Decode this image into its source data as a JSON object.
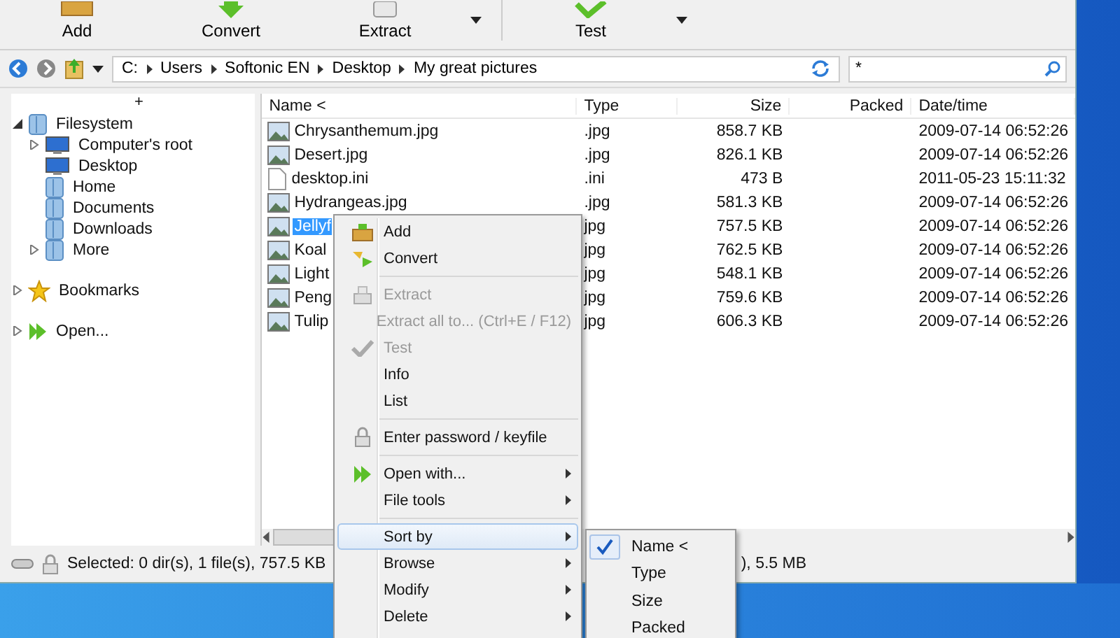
{
  "toolbar": {
    "buttons": [
      {
        "label": "Add",
        "dropdown": false
      },
      {
        "label": "Convert",
        "dropdown": false
      },
      {
        "label": "Extract",
        "dropdown": true
      },
      {
        "label": "Test",
        "dropdown": true
      }
    ]
  },
  "address_bar": {
    "path": [
      "C:",
      "Users",
      "Softonic EN",
      "Desktop",
      "My great pictures"
    ],
    "filter": "*"
  },
  "sidebar": {
    "expand_mark": "+",
    "items": [
      {
        "label": "Filesystem",
        "expanded": true,
        "children": [
          {
            "label": "Computer's root",
            "expanded": false
          },
          {
            "label": "Desktop"
          },
          {
            "label": "Home"
          },
          {
            "label": "Documents"
          },
          {
            "label": "Downloads"
          },
          {
            "label": "More",
            "expanded": false
          }
        ]
      },
      {
        "label": "Bookmarks",
        "expanded": false
      },
      {
        "label": "Open...",
        "expanded": false
      }
    ]
  },
  "table": {
    "columns": [
      "Name <",
      "Type",
      "Size",
      "Packed",
      "Date/time"
    ],
    "rows": [
      {
        "kind": "image",
        "name": "Chrysanthemum.jpg",
        "type": ".jpg",
        "size": "858.7 KB",
        "date": "2009-07-14 06:52:26",
        "selected": false
      },
      {
        "kind": "image",
        "name": "Desert.jpg",
        "type": ".jpg",
        "size": "826.1 KB",
        "date": "2009-07-14 06:52:26",
        "selected": false
      },
      {
        "kind": "document",
        "name": "desktop.ini",
        "type": ".ini",
        "size": "473 B",
        "date": "2011-05-23 15:11:32",
        "selected": false
      },
      {
        "kind": "image",
        "name": "Hydrangeas.jpg",
        "type": ".jpg",
        "size": "581.3 KB",
        "date": "2009-07-14 06:52:26",
        "selected": false
      },
      {
        "kind": "image",
        "name": "Jellyf",
        "type": "jpg",
        "size": "757.5 KB",
        "date": "2009-07-14 06:52:26",
        "selected": true
      },
      {
        "kind": "image",
        "name": "Koal",
        "type": "jpg",
        "size": "762.5 KB",
        "date": "2009-07-14 06:52:26",
        "selected": false
      },
      {
        "kind": "image",
        "name": "Light",
        "type": "jpg",
        "size": "548.1 KB",
        "date": "2009-07-14 06:52:26",
        "selected": false
      },
      {
        "kind": "image",
        "name": "Peng",
        "type": "jpg",
        "size": "759.6 KB",
        "date": "2009-07-14 06:52:26",
        "selected": false
      },
      {
        "kind": "image",
        "name": "Tulip",
        "type": "jpg",
        "size": "606.3 KB",
        "date": "2009-07-14 06:52:26",
        "selected": false
      }
    ]
  },
  "status_bar": {
    "selection": "Selected: 0 dir(s), 1 file(s), 757.5 KB",
    "total": "), 5.5 MB"
  },
  "context_menu": {
    "items": [
      {
        "kind": "item",
        "label": "Add",
        "disabled": false,
        "submenu": false,
        "highlighted": false
      },
      {
        "kind": "item",
        "label": "Convert",
        "disabled": false,
        "submenu": false,
        "highlighted": false
      },
      {
        "kind": "separator"
      },
      {
        "kind": "item",
        "label": "Extract",
        "disabled": true,
        "submenu": false,
        "highlighted": false
      },
      {
        "kind": "item",
        "label": "Extract all to... (Ctrl+E / F12)",
        "disabled": true,
        "submenu": false,
        "highlighted": false
      },
      {
        "kind": "item",
        "label": "Test",
        "disabled": true,
        "submenu": false,
        "highlighted": false
      },
      {
        "kind": "item",
        "label": "Info",
        "disabled": false,
        "submenu": false,
        "highlighted": false
      },
      {
        "kind": "item",
        "label": "List",
        "disabled": false,
        "submenu": false,
        "highlighted": false
      },
      {
        "kind": "separator"
      },
      {
        "kind": "item",
        "label": "Enter password / keyfile",
        "disabled": false,
        "submenu": false,
        "highlighted": false
      },
      {
        "kind": "separator"
      },
      {
        "kind": "item",
        "label": "Open with...",
        "disabled": false,
        "submenu": true,
        "highlighted": false
      },
      {
        "kind": "item",
        "label": "File tools",
        "disabled": false,
        "submenu": true,
        "highlighted": false
      },
      {
        "kind": "separator"
      },
      {
        "kind": "item",
        "label": "Sort by",
        "disabled": false,
        "submenu": true,
        "highlighted": true
      },
      {
        "kind": "item",
        "label": "Browse",
        "disabled": false,
        "submenu": true,
        "highlighted": false
      },
      {
        "kind": "item",
        "label": "Modify",
        "disabled": false,
        "submenu": true,
        "highlighted": false
      },
      {
        "kind": "item",
        "label": "Delete",
        "disabled": false,
        "submenu": true,
        "highlighted": false
      }
    ]
  },
  "sort_submenu": {
    "items": [
      {
        "label": "Name <",
        "checked": true
      },
      {
        "label": "Type",
        "checked": false
      },
      {
        "label": "Size",
        "checked": false
      },
      {
        "label": "Packed",
        "checked": false
      }
    ]
  }
}
